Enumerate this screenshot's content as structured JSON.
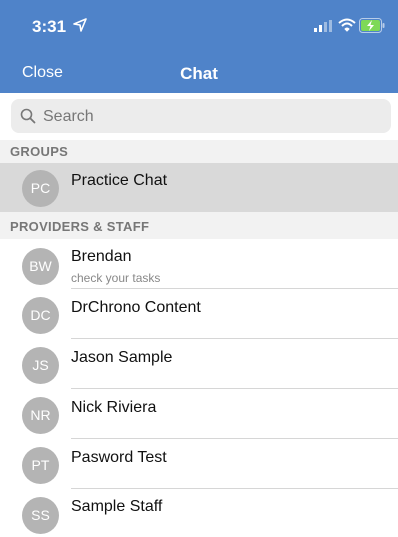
{
  "status_bar": {
    "time": "3:31",
    "icons": [
      "location-arrow-icon",
      "signal-icon",
      "wifi-icon",
      "battery-charging-icon"
    ]
  },
  "nav": {
    "close_label": "Close",
    "title": "Chat"
  },
  "search": {
    "placeholder": "Search",
    "value": ""
  },
  "sections": {
    "groups": "GROUPS",
    "providers": "PROVIDERS & STAFF"
  },
  "groups": [
    {
      "initials": "PC",
      "name": "Practice Chat",
      "selected": true
    }
  ],
  "contacts": [
    {
      "initials": "BW",
      "name": "Brendan",
      "subtitle": "check your tasks"
    },
    {
      "initials": "DC",
      "name": "DrChrono Content"
    },
    {
      "initials": "JS",
      "name": "Jason Sample"
    },
    {
      "initials": "NR",
      "name": "Nick Riviera"
    },
    {
      "initials": "PT",
      "name": "Pasword Test"
    },
    {
      "initials": "SS",
      "name": "Sample Staff"
    }
  ],
  "colors": {
    "header": "#4f83c9",
    "avatar": "#b4b4b4",
    "selected_row": "#d9d9d9",
    "section_header": "#f2f2f2"
  }
}
